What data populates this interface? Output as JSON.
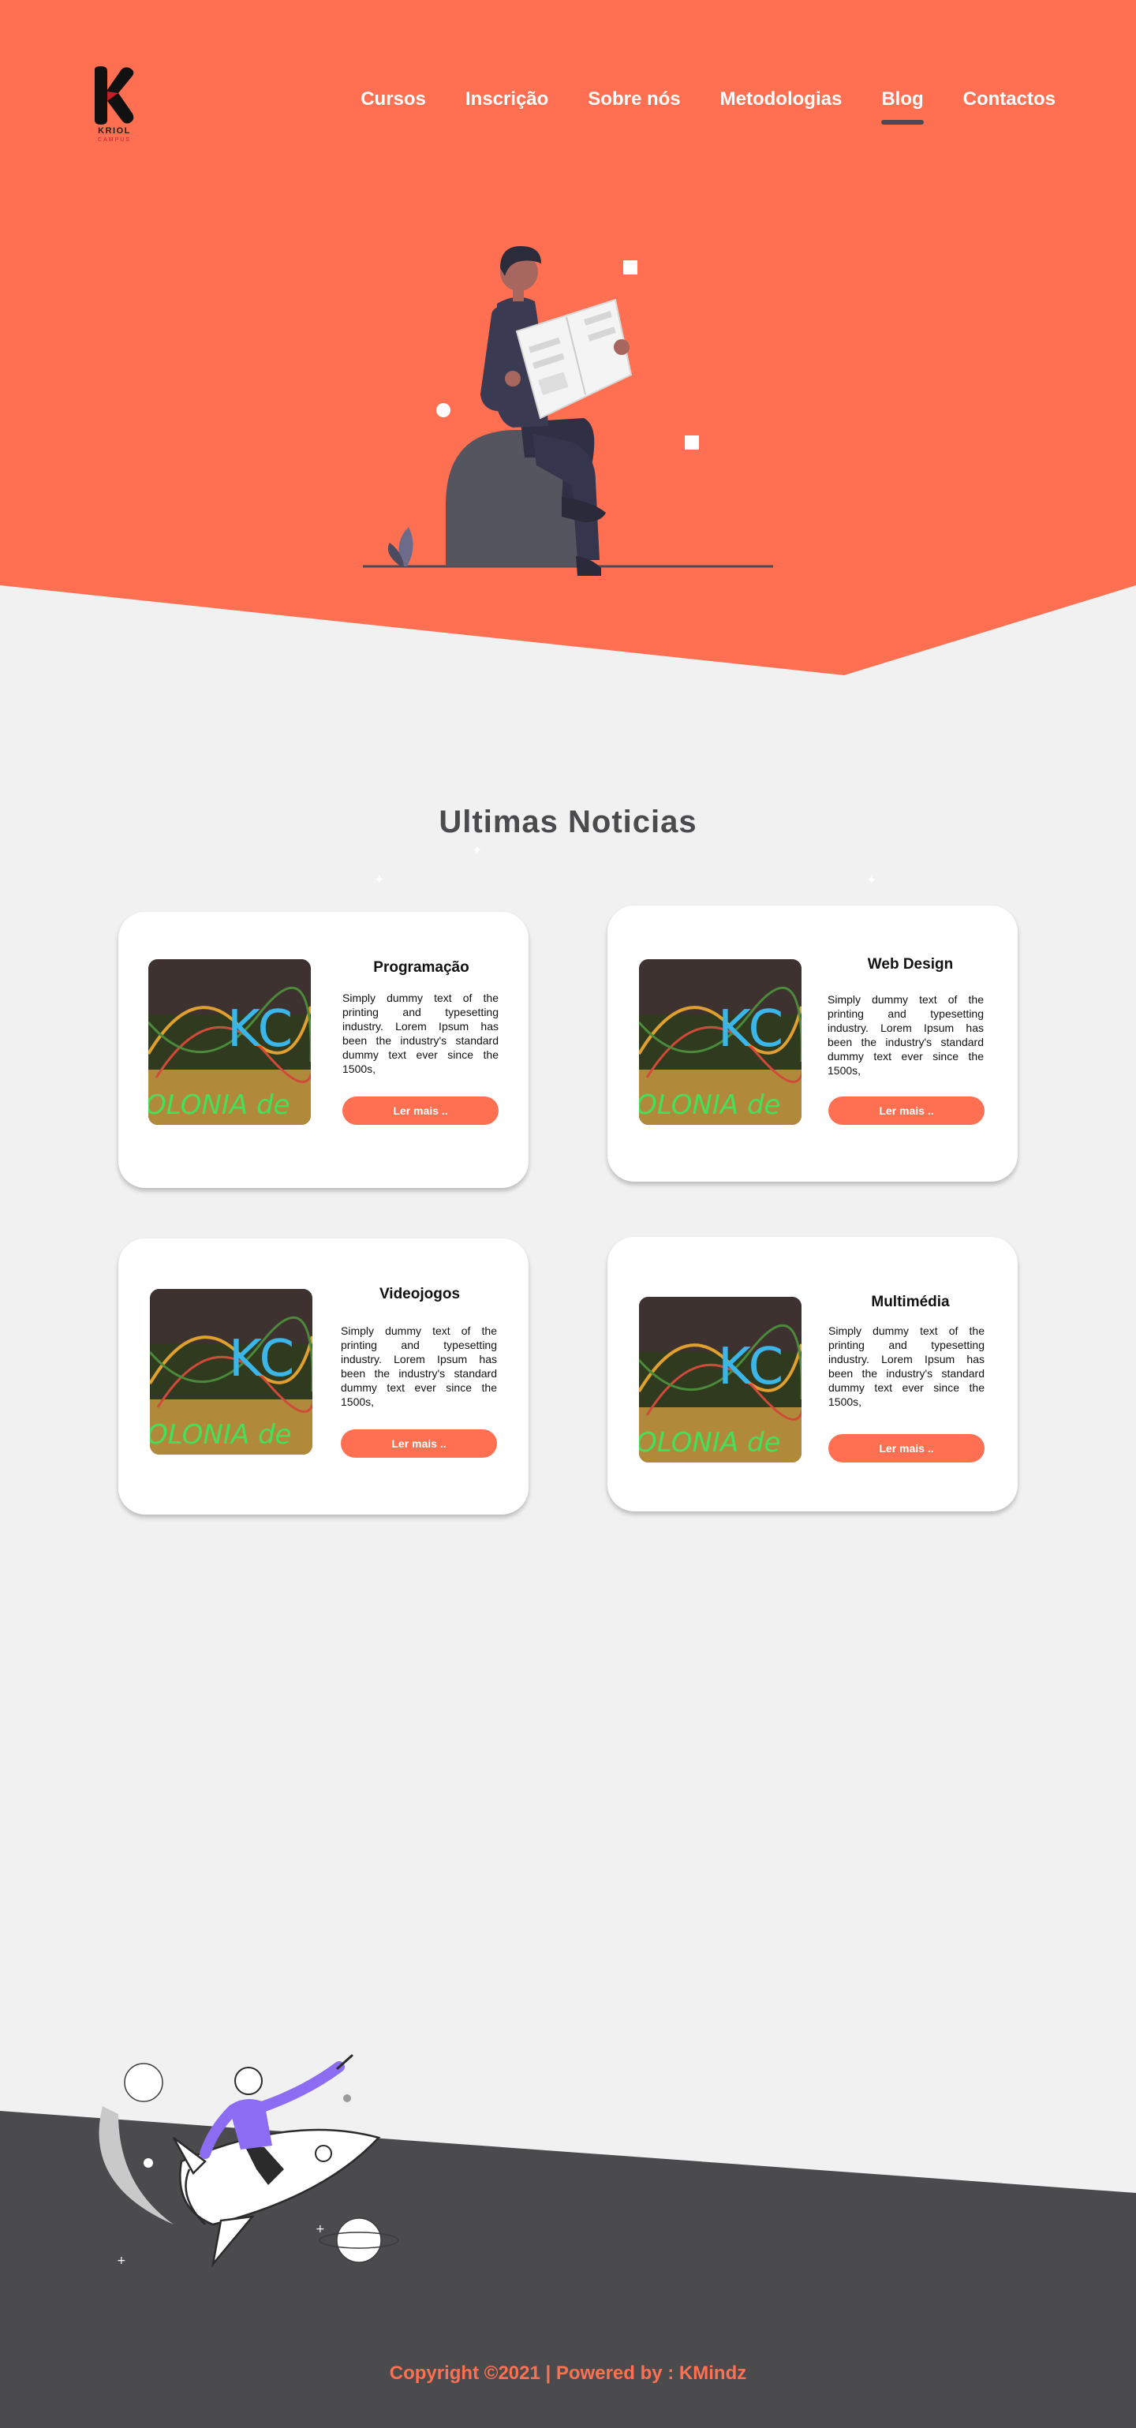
{
  "colors": {
    "accent": "#fe7051",
    "dark": "#4b4b4d",
    "background": "#f1f1f1",
    "card": "#ffffff"
  },
  "brand": {
    "name": "KRIOL",
    "tagline": "CAMPUS",
    "icon": "k-logo-icon"
  },
  "nav": {
    "items": [
      {
        "label": "Cursos"
      },
      {
        "label": "Inscrição"
      },
      {
        "label": "Sobre nós"
      },
      {
        "label": "Metodologias"
      },
      {
        "label": "Blog",
        "active": true
      },
      {
        "label": "Contactos"
      }
    ]
  },
  "hero": {
    "illustration": "man-reading-newspaper-illustration"
  },
  "news": {
    "title": "Ultimas Noticias",
    "cards": [
      {
        "title": "Programação",
        "text": "Simply dummy text of the printing and typesetting industry. Lorem Ipsum has been the industry's standard dummy text ever since the 1500s,",
        "button": "Ler mais ..",
        "image": "robotics-workshop-photo"
      },
      {
        "title": "Web Design",
        "text": "Simply dummy text of the printing and typesetting industry. Lorem Ipsum has been the industry's standard dummy text ever since the 1500s,",
        "button": "Ler mais ..",
        "image": "robotics-workshop-photo"
      },
      {
        "title": "Videojogos",
        "text": "Simply dummy text of the printing and typesetting industry. Lorem Ipsum has been the industry's standard dummy text ever since the 1500s,",
        "button": "Ler mais ..",
        "image": "robotics-workshop-photo"
      },
      {
        "title": "Multimédia",
        "text": "Simply dummy text of the printing and typesetting industry. Lorem Ipsum has been the industry's standard dummy text ever since the 1500s,",
        "button": "Ler mais ..",
        "image": "robotics-workshop-photo"
      }
    ]
  },
  "footer": {
    "illustration": "person-riding-rocket-illustration",
    "copyright": "Copyright ©2021 | Powered by : KMindz"
  }
}
